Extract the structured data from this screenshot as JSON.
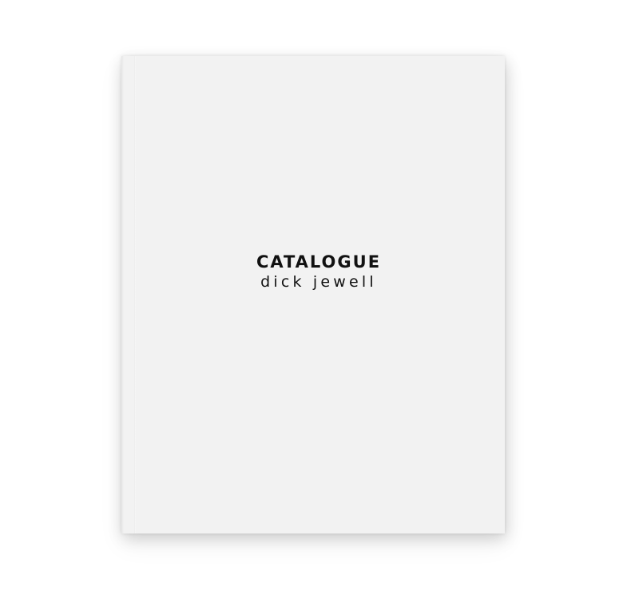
{
  "cover": {
    "title": "CATALOGUE",
    "author": "dick jewell"
  }
}
